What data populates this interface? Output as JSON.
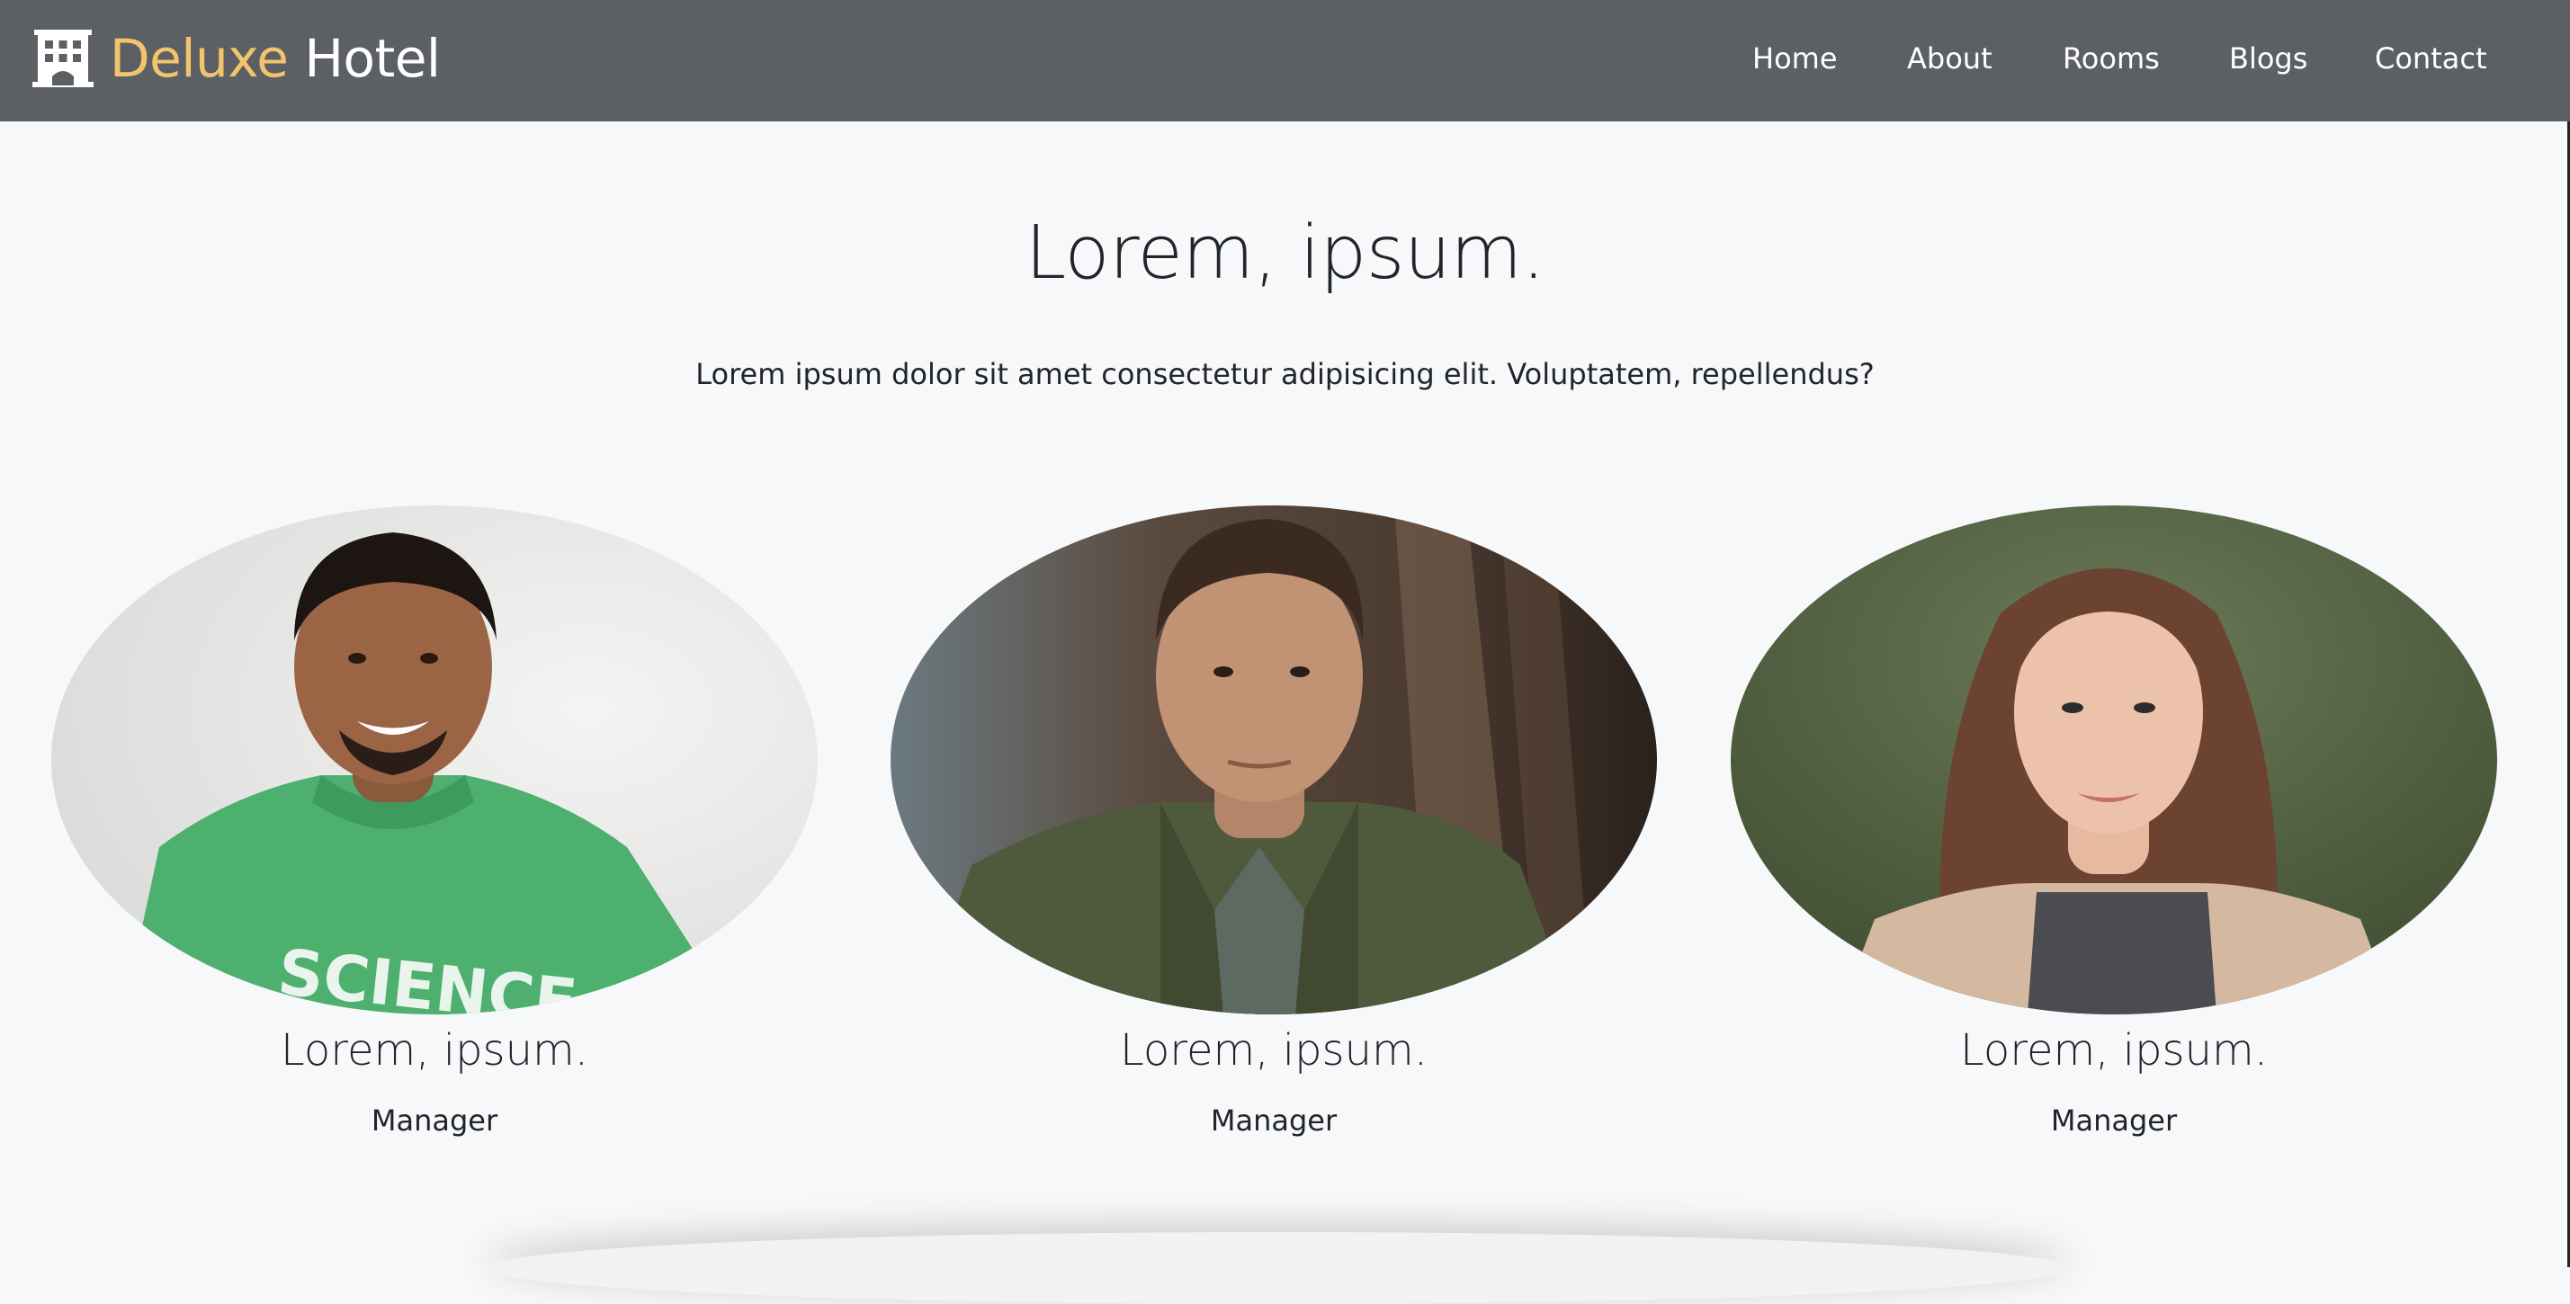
{
  "navbar": {
    "brand_accent": "Deluxe",
    "brand_rest": " Hotel",
    "brand_icon": "hotel-building-icon",
    "links": [
      {
        "label": "Home"
      },
      {
        "label": "About"
      },
      {
        "label": "Rooms"
      },
      {
        "label": "Blogs"
      },
      {
        "label": "Contact"
      }
    ]
  },
  "hero": {
    "title": "Lorem, ipsum.",
    "subtitle": "Lorem ipsum dolor sit amet consectetur adipisicing elit. Voluptatem, repellendus?"
  },
  "team": [
    {
      "name": "Lorem, ipsum.",
      "role": "Manager",
      "photo": "smiling man in green science t-shirt"
    },
    {
      "name": "Lorem, ipsum.",
      "role": "Manager",
      "photo": "man in olive jacket, blurred tree background"
    },
    {
      "name": "Lorem, ipsum.",
      "role": "Manager",
      "photo": "woman with long brown hair, green background"
    }
  ],
  "colors": {
    "navbar_bg": "#5c6065",
    "brand_accent": "#f3c56b",
    "page_bg": "#f7f8fa",
    "text": "#212529"
  }
}
